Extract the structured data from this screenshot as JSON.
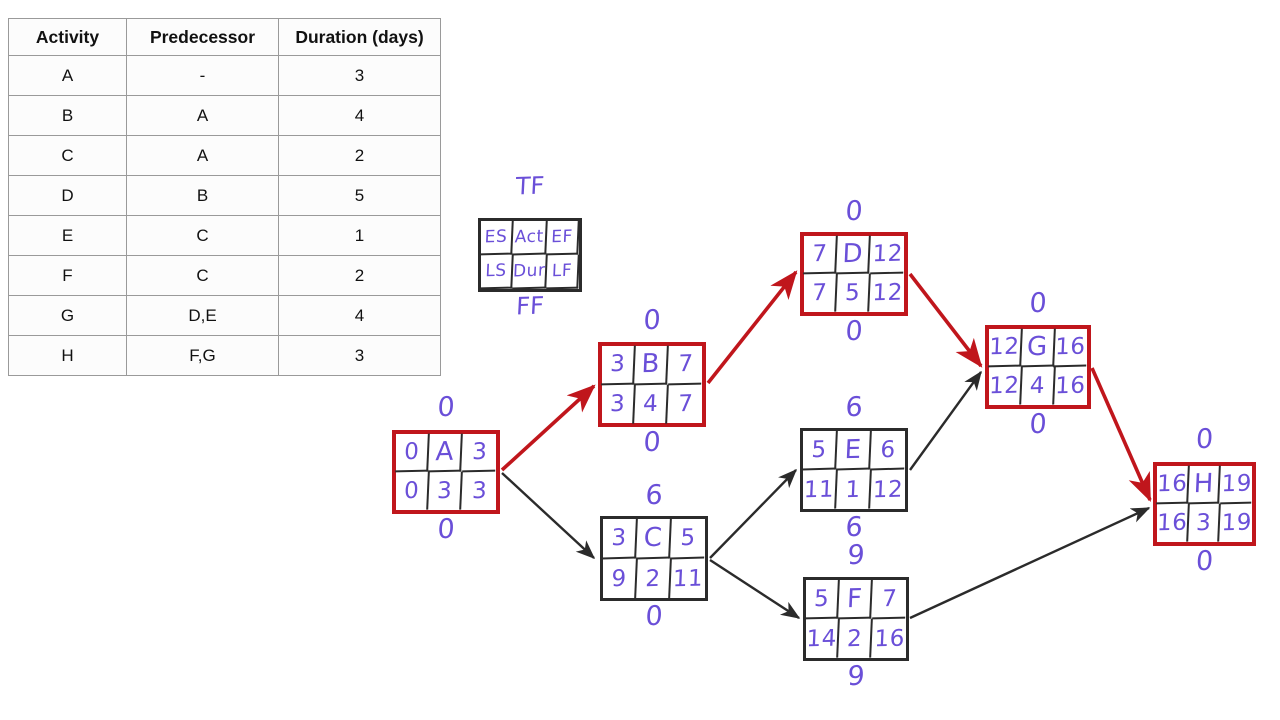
{
  "table": {
    "headers": [
      "Activity",
      "Predecessor",
      "Duration (days)"
    ],
    "rows": [
      {
        "activity": "A",
        "predecessor": "-",
        "duration": "3"
      },
      {
        "activity": "B",
        "predecessor": "A",
        "duration": "4"
      },
      {
        "activity": "C",
        "predecessor": "A",
        "duration": "2"
      },
      {
        "activity": "D",
        "predecessor": "B",
        "duration": "5"
      },
      {
        "activity": "E",
        "predecessor": "C",
        "duration": "1"
      },
      {
        "activity": "F",
        "predecessor": "C",
        "duration": "2"
      },
      {
        "activity": "G",
        "predecessor": "D,E",
        "duration": "4"
      },
      {
        "activity": "H",
        "predecessor": "F,G",
        "duration": "3"
      }
    ]
  },
  "legend": {
    "tf": "TF",
    "ff": "FF",
    "es": "ES",
    "act": "Act",
    "ef": "EF",
    "ls": "LS",
    "dur": "Dur",
    "lf": "LF"
  },
  "colors": {
    "critical": "#c0161c",
    "normal": "#2b2b2b",
    "handwriting": "#6a4fd8"
  },
  "nodes": {
    "A": {
      "es": "0",
      "act": "A",
      "ef": "3",
      "ls": "0",
      "dur": "3",
      "lf": "3",
      "tf": "0",
      "ff": "0",
      "critical": true
    },
    "B": {
      "es": "3",
      "act": "B",
      "ef": "7",
      "ls": "3",
      "dur": "4",
      "lf": "7",
      "tf": "0",
      "ff": "0",
      "critical": true
    },
    "C": {
      "es": "3",
      "act": "C",
      "ef": "5",
      "ls": "9",
      "dur": "2",
      "lf": "11",
      "tf": "6",
      "ff": "0",
      "critical": false
    },
    "D": {
      "es": "7",
      "act": "D",
      "ef": "12",
      "ls": "7",
      "dur": "5",
      "lf": "12",
      "tf": "0",
      "ff": "0",
      "critical": true
    },
    "E": {
      "es": "5",
      "act": "E",
      "ef": "6",
      "ls": "11",
      "dur": "1",
      "lf": "12",
      "tf": "6",
      "ff": "6",
      "critical": false
    },
    "F": {
      "es": "5",
      "act": "F",
      "ef": "7",
      "ls": "14",
      "dur": "2",
      "lf": "16",
      "tf": "9",
      "ff": "9",
      "critical": false
    },
    "G": {
      "es": "12",
      "act": "G",
      "ef": "16",
      "ls": "12",
      "dur": "4",
      "lf": "16",
      "tf": "0",
      "ff": "0",
      "critical": true
    },
    "H": {
      "es": "16",
      "act": "H",
      "ef": "19",
      "ls": "16",
      "dur": "3",
      "lf": "19",
      "tf": "0",
      "ff": "0",
      "critical": true
    }
  },
  "edges": [
    {
      "from": "A",
      "to": "B",
      "critical": true
    },
    {
      "from": "A",
      "to": "C",
      "critical": false
    },
    {
      "from": "B",
      "to": "D",
      "critical": true
    },
    {
      "from": "C",
      "to": "E",
      "critical": false
    },
    {
      "from": "C",
      "to": "F",
      "critical": false
    },
    {
      "from": "D",
      "to": "G",
      "critical": true
    },
    {
      "from": "E",
      "to": "G",
      "critical": false
    },
    {
      "from": "F",
      "to": "H",
      "critical": false
    },
    {
      "from": "G",
      "to": "H",
      "critical": true
    }
  ]
}
